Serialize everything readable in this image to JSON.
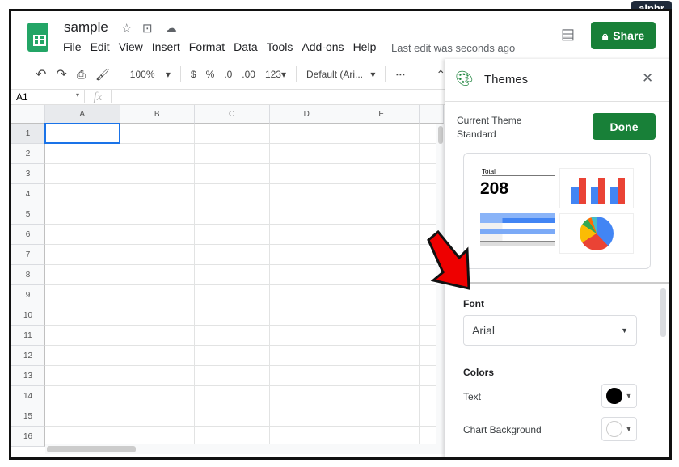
{
  "watermark": "alphr",
  "doc": {
    "title": "sample",
    "last_edit": "Last edit was seconds ago"
  },
  "menu": [
    "File",
    "Edit",
    "View",
    "Insert",
    "Format",
    "Data",
    "Tools",
    "Add-ons",
    "Help"
  ],
  "share_label": "Share",
  "toolbar": {
    "zoom": "100%",
    "currency": "$",
    "percent": "%",
    "dec_decrease": ".0",
    "dec_increase": ".00",
    "format": "123",
    "font": "Default (Ari..."
  },
  "formula_bar": {
    "cell_ref": "A1",
    "fx": "fx"
  },
  "columns": [
    "A",
    "B",
    "C",
    "D",
    "E"
  ],
  "rows": [
    "1",
    "2",
    "3",
    "4",
    "5",
    "6",
    "7",
    "8",
    "9",
    "10",
    "11",
    "12",
    "13",
    "14",
    "15",
    "16"
  ],
  "panel": {
    "title": "Themes",
    "current_theme_label": "Current Theme",
    "current_theme": "Standard",
    "done": "Done",
    "preview": {
      "total_label": "Total",
      "total_value": "208"
    },
    "font_label": "Font",
    "font_value": "Arial",
    "colors_label": "Colors",
    "color_rows": [
      {
        "label": "Text",
        "color": "#000000"
      },
      {
        "label": "Chart Background",
        "color": "#ffffff"
      }
    ]
  },
  "colors": {
    "accent": "#188038",
    "blue": "#4285f4",
    "red": "#ea4335",
    "yellow": "#fbbc04",
    "green": "#34a853"
  }
}
